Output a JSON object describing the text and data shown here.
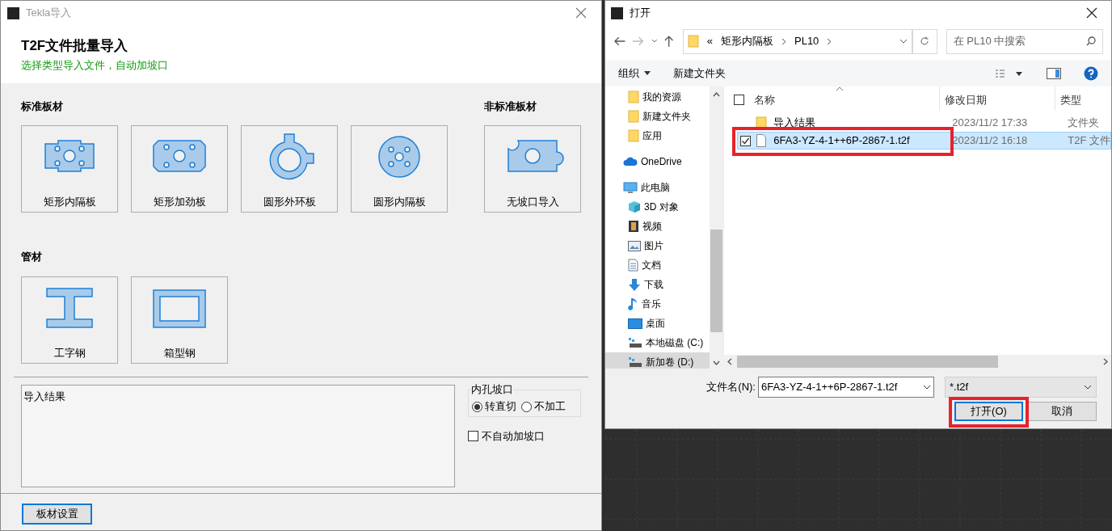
{
  "import_window": {
    "title": "Tekla导入",
    "heading": "T2F文件批量导入",
    "subtitle": "选择类型导入文件，自动加坡口",
    "sections": [
      {
        "title": "标准板材",
        "items": [
          {
            "kind": "rect-plate",
            "label": "矩形内隔板"
          },
          {
            "kind": "rect-stiffener",
            "label": "矩形加劲板"
          },
          {
            "kind": "ring-plate",
            "label": "圆形外环板"
          },
          {
            "kind": "round-plate",
            "label": "圆形内隔板"
          }
        ]
      },
      {
        "title": "非标准板材",
        "items": [
          {
            "kind": "no-bevel",
            "label": "无坡口导入"
          }
        ]
      },
      {
        "title": "管材",
        "items": [
          {
            "kind": "i-beam",
            "label": "工字钢"
          },
          {
            "kind": "box-section",
            "label": "箱型钢"
          }
        ]
      }
    ],
    "result_box": {
      "value": "导入结果"
    },
    "hole_bevel": {
      "title": "内孔坡口",
      "options": [
        {
          "label": "转直切",
          "selected": true
        },
        {
          "label": "不加工",
          "selected": false
        }
      ]
    },
    "no_auto_bevel": {
      "label": "不自动加坡口",
      "checked": false
    },
    "settings_button": "板材设置"
  },
  "open_dialog": {
    "title": "打开",
    "breadcrumb": [
      "«",
      "矩形内隔板",
      "PL10"
    ],
    "search": {
      "placeholder": "在 PL10 中搜索"
    },
    "toolbar": [
      "组织",
      "新建文件夹"
    ],
    "nav": [
      {
        "kind": "folder",
        "label": "我的资源",
        "selected": false
      },
      {
        "kind": "folder",
        "label": "新建文件夹",
        "selected": false
      },
      {
        "kind": "folder",
        "label": "应用",
        "selected": false
      },
      {
        "kind": "cloud",
        "label": "OneDrive",
        "selected": false
      },
      {
        "kind": "pc",
        "label": "此电脑",
        "selected": false
      },
      {
        "kind": "cube",
        "label": "3D 对象",
        "selected": false
      },
      {
        "kind": "film",
        "label": "视频",
        "selected": false
      },
      {
        "kind": "picture",
        "label": "图片",
        "selected": false
      },
      {
        "kind": "doc",
        "label": "文档",
        "selected": false
      },
      {
        "kind": "download",
        "label": "下载",
        "selected": false
      },
      {
        "kind": "music",
        "label": "音乐",
        "selected": false
      },
      {
        "kind": "desktop",
        "label": "桌面",
        "selected": false
      },
      {
        "kind": "drive",
        "label": "本地磁盘 (C:)",
        "selected": false
      },
      {
        "kind": "drive",
        "label": "新加卷 (D:)",
        "selected": true
      }
    ],
    "select_all": {
      "checked": false
    },
    "columns": [
      "名称",
      "修改日期",
      "类型"
    ],
    "files": [
      {
        "kind": "folder",
        "name": "导入结果",
        "date": "2023/11/2 17:33",
        "type": "文件夹",
        "selected": false,
        "checked": false,
        "annotated": false
      },
      {
        "kind": "file",
        "name": "6FA3-YZ-4-1++6P-2867-1.t2f",
        "date": "2023/11/2 16:18",
        "type": "T2F 文件",
        "selected": true,
        "checked": true,
        "annotated": true
      }
    ],
    "filename_label": "文件名(N):",
    "filename": "6FA3-YZ-4-1++6P-2867-1.t2f",
    "filter": "*.t2f",
    "open_button": {
      "label": "打开(O)",
      "annotated": true
    },
    "cancel_button": "取消"
  }
}
